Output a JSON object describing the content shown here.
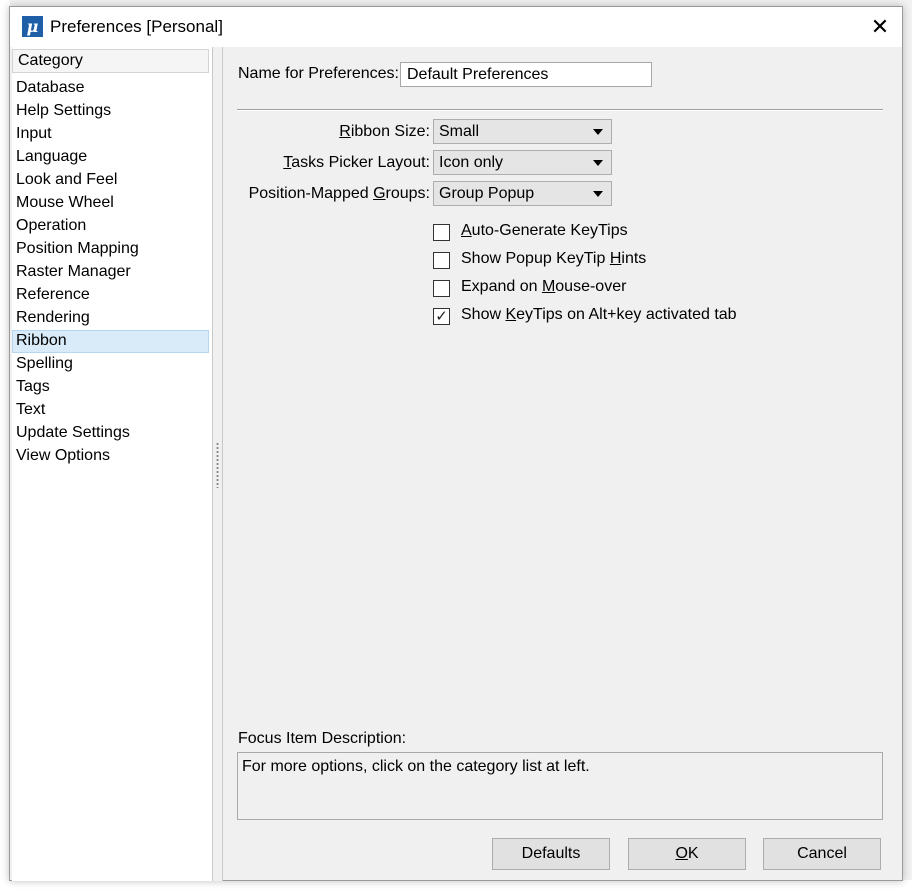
{
  "window": {
    "title": "Preferences [Personal]",
    "app_icon_glyph": "μ",
    "close_glyph": "✕"
  },
  "category": {
    "header": "Category",
    "items": [
      "Database",
      "Help Settings",
      "Input",
      "Language",
      "Look and Feel",
      "Mouse Wheel",
      "Operation",
      "Position Mapping",
      "Raster Manager",
      "Reference",
      "Rendering",
      "Ribbon",
      "Spelling",
      "Tags",
      "Text",
      "Update Settings",
      "View Options"
    ],
    "selected": "Ribbon"
  },
  "name_for_preferences": {
    "label": "Name for Preferences:",
    "value": "Default Preferences"
  },
  "ribbon_size": {
    "label_pre": "",
    "label_key": "R",
    "label_post": "ibbon Size:",
    "value": "Small"
  },
  "tasks_picker_layout": {
    "label_pre": "",
    "label_key": "T",
    "label_post": "asks Picker Layout:",
    "value": "Icon only"
  },
  "position_mapped_groups": {
    "label_pre": "Position-Mapped ",
    "label_key": "G",
    "label_post": "roups:",
    "value": "Group Popup"
  },
  "checkboxes": {
    "auto_generate": {
      "pre": "",
      "key": "A",
      "post": "uto-Generate KeyTips",
      "checked": false
    },
    "show_popup_hints": {
      "pre": "Show Popup KeyTip ",
      "key": "H",
      "post": "ints",
      "checked": false
    },
    "expand_mouse_over": {
      "pre": "Expand on ",
      "key": "M",
      "post": "ouse-over",
      "checked": false
    },
    "show_keytips_alt": {
      "pre": "Show ",
      "key": "K",
      "post": "eyTips on Alt+key activated tab",
      "checked": true
    }
  },
  "check_glyph": "✓",
  "focus_description": {
    "label": "Focus Item Description:",
    "text": "For more options, click on the category list at left."
  },
  "buttons": {
    "defaults": "Defaults",
    "ok_key": "O",
    "ok_post": "K",
    "cancel": "Cancel"
  },
  "colors": {
    "selection_bg": "#d9ebf9",
    "selection_border": "#b6d6f2",
    "app_icon": "#1f5fa8"
  }
}
